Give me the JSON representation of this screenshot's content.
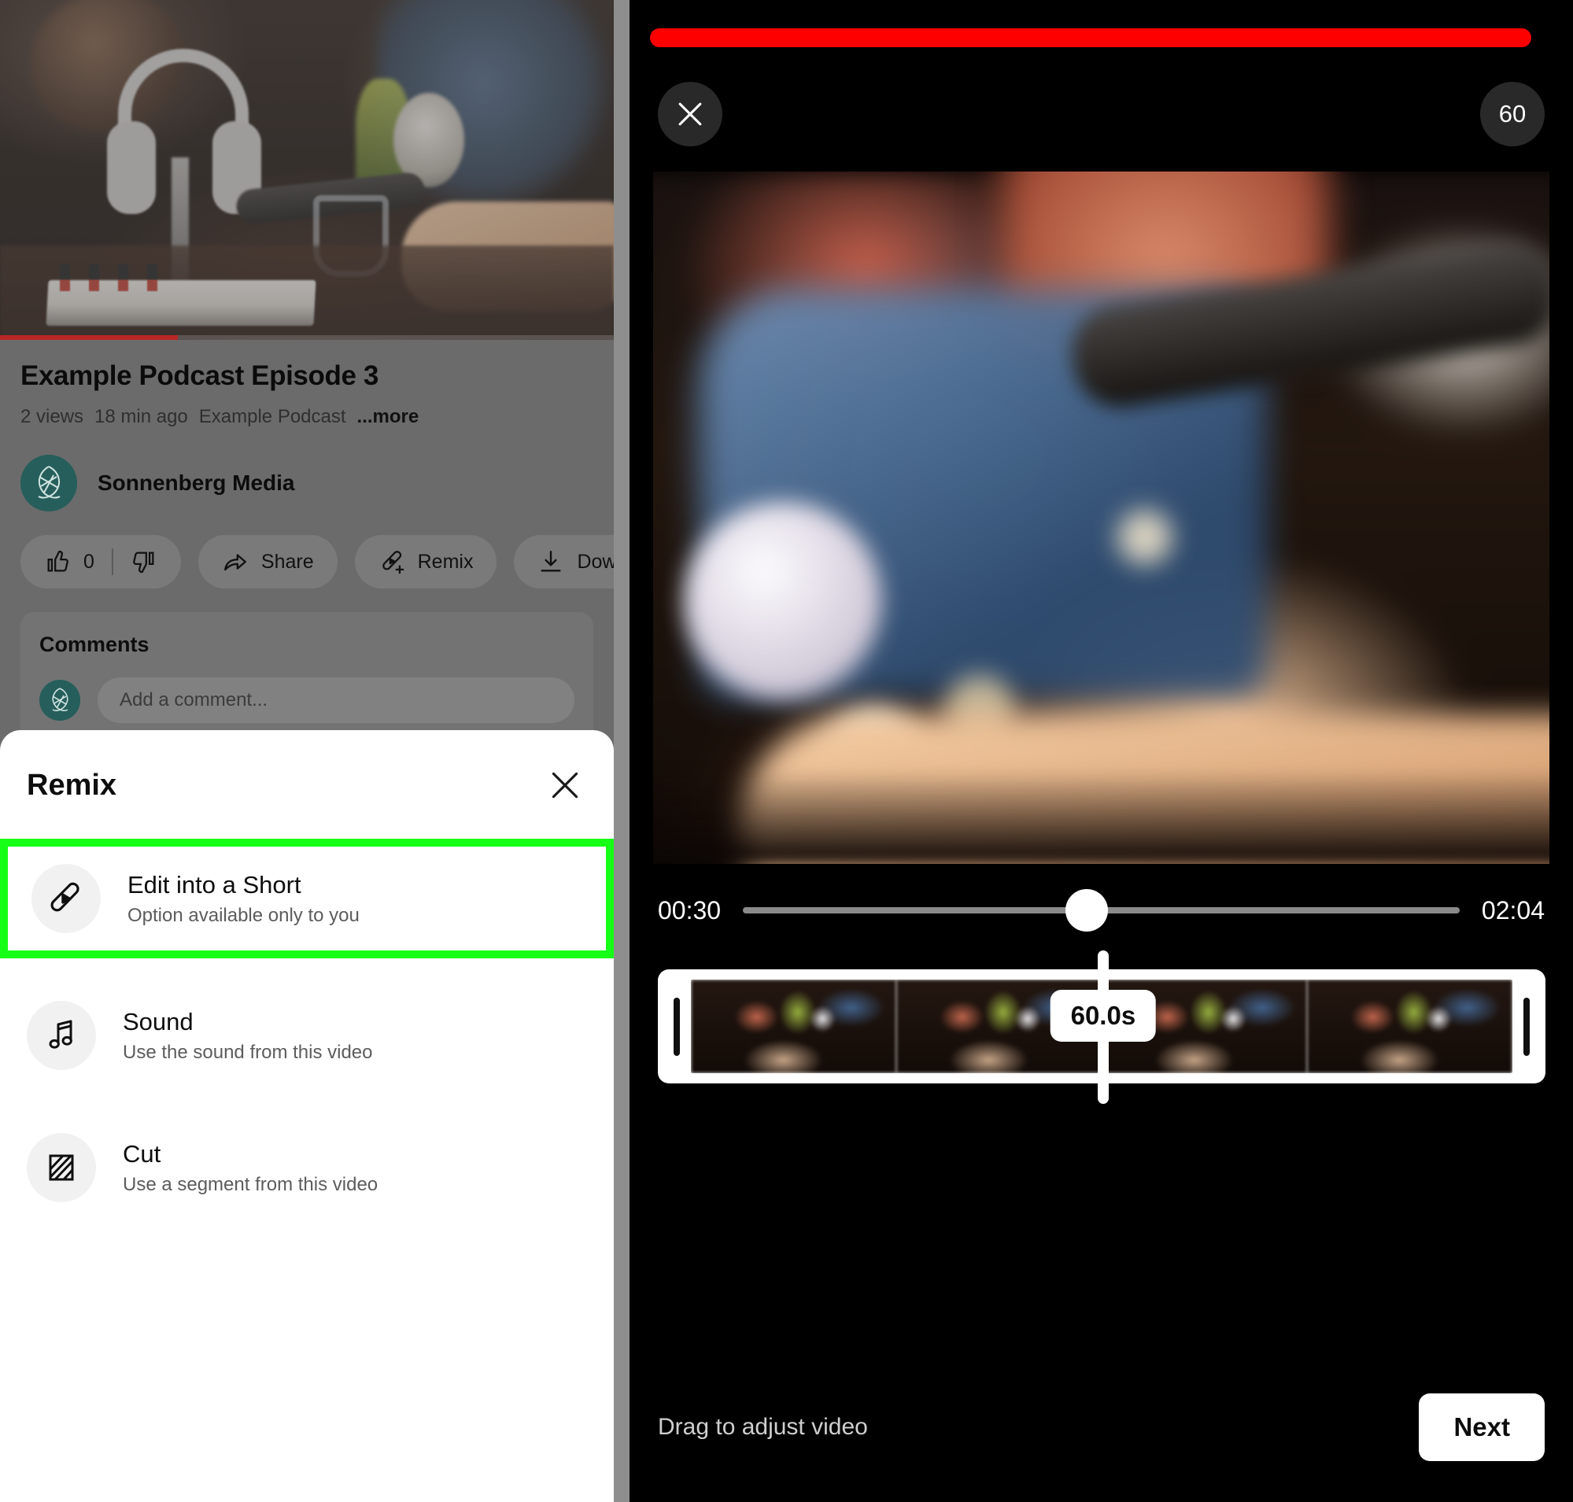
{
  "colors": {
    "youtube_red": "#ff0000",
    "highlight_green": "#16ff16",
    "avatar_teal": "#265e5b",
    "sheet_background": "#ffffff",
    "dim_overlay": "#6b6b6b"
  },
  "left_panel": {
    "video": {
      "title": "Example Podcast Episode 3",
      "views": "2 views",
      "published": "18 min ago",
      "channel_tag": "Example Podcast",
      "more_label": "...more",
      "progress_percent": 29
    },
    "channel": {
      "name": "Sonnenberg Media",
      "avatar_icon": "sonnenberg-leaf-logo"
    },
    "actions": [
      {
        "name": "like",
        "icon": "thumbs-up-icon",
        "label": "0"
      },
      {
        "name": "dislike",
        "icon": "thumbs-down-icon",
        "label": ""
      },
      {
        "name": "share",
        "icon": "share-arrow-icon",
        "label": "Share"
      },
      {
        "name": "remix",
        "icon": "remix-icon",
        "label": "Remix"
      },
      {
        "name": "download",
        "icon": "download-icon",
        "label": "Download"
      }
    ],
    "comments": {
      "heading": "Comments",
      "compose_placeholder": "Add a comment..."
    },
    "remix_sheet": {
      "title": "Remix",
      "close_icon": "close-icon",
      "items": [
        {
          "icon": "edit-into-short-icon",
          "title": "Edit into a Short",
          "subtitle": "Option available only to you",
          "highlighted": true
        },
        {
          "icon": "music-note-icon",
          "title": "Sound",
          "subtitle": "Use the sound from this video",
          "highlighted": false
        },
        {
          "icon": "cut-scissors-icon",
          "title": "Cut",
          "subtitle": "Use a segment from this video",
          "highlighted": false
        }
      ]
    }
  },
  "right_panel": {
    "close_icon": "close-icon",
    "duration_badge": "60",
    "scrubber": {
      "start_time": "00:30",
      "end_time": "02:04",
      "knob_position_percent": 48
    },
    "trim": {
      "selected_duration": "60.0s",
      "left_handle_icon": "trim-handle-left",
      "right_handle_icon": "trim-handle-right"
    },
    "bottom": {
      "hint": "Drag to adjust video",
      "next_label": "Next"
    }
  }
}
